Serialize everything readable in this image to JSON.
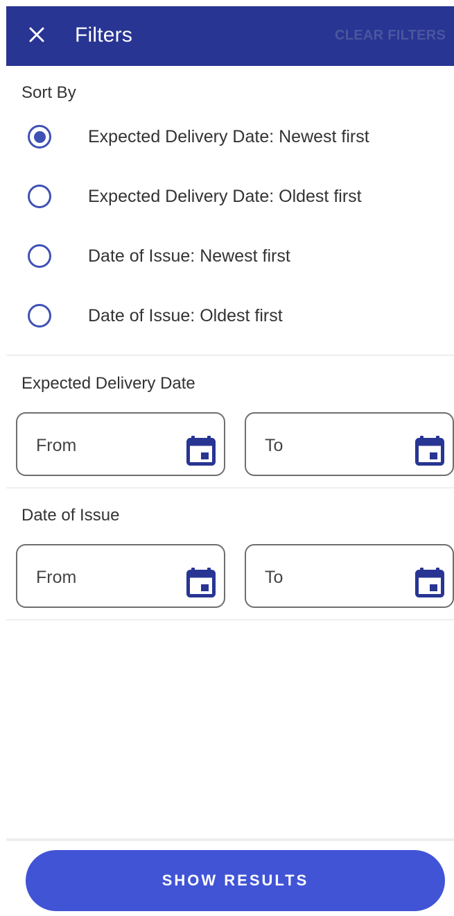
{
  "header": {
    "title": "Filters",
    "clear_label": "CLEAR FILTERS",
    "close_icon": "close-icon",
    "background": "#283593"
  },
  "sort": {
    "label": "Sort By",
    "options": [
      {
        "label": "Expected Delivery Date: Newest first",
        "selected": true
      },
      {
        "label": "Expected Delivery Date: Oldest first",
        "selected": false
      },
      {
        "label": "Date of Issue: Newest first",
        "selected": false
      },
      {
        "label": "Date of Issue: Oldest first",
        "selected": false
      }
    ]
  },
  "expected_delivery": {
    "label": "Expected Delivery Date",
    "from_placeholder": "From",
    "to_placeholder": "To"
  },
  "date_of_issue": {
    "label": "Date of Issue",
    "from_placeholder": "From",
    "to_placeholder": "To"
  },
  "footer": {
    "show_results_label": "SHOW RESULTS",
    "button_color": "#4154d6"
  },
  "colors": {
    "accent": "#3f51b5",
    "icon": "#283593"
  }
}
